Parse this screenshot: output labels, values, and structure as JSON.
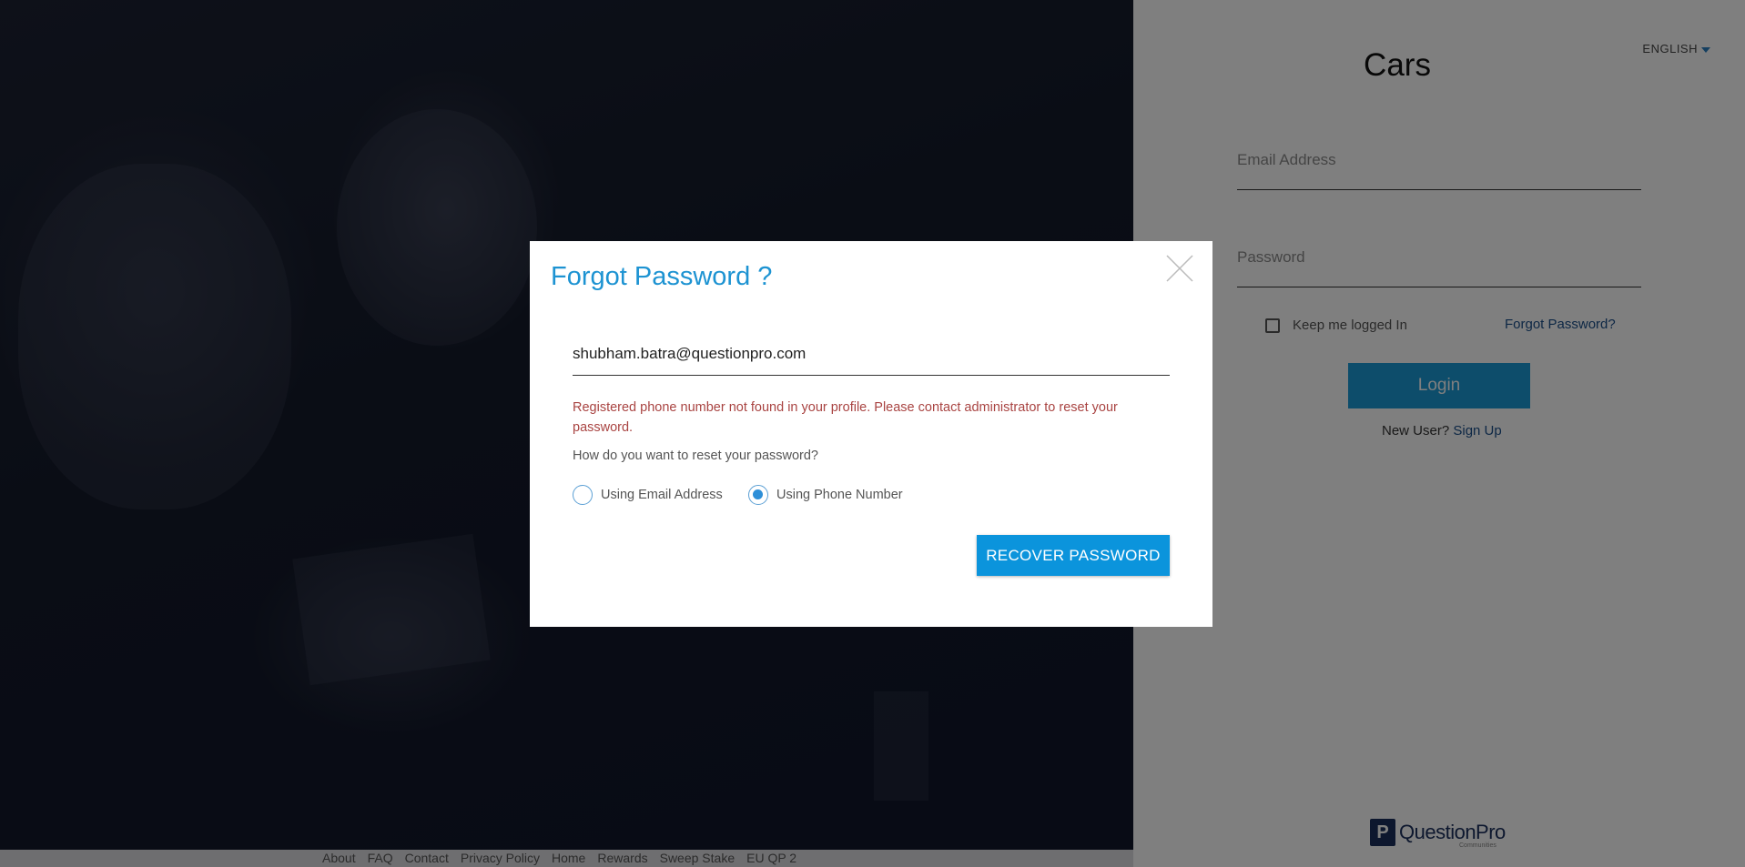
{
  "login_panel": {
    "language": "ENGLISH",
    "app_title": "Cars",
    "email_placeholder": "Email Address",
    "password_placeholder": "Password",
    "keep_logged_in": "Keep me logged In",
    "forgot_password_link": "Forgot Password?",
    "login_button": "Login",
    "new_user_text": "New User?",
    "sign_up_link": "Sign Up",
    "brand_name": "QuestionPro",
    "brand_sub": "Communities"
  },
  "footer": {
    "links": [
      "About",
      "FAQ",
      "Contact",
      "Privacy Policy",
      "Home",
      "Rewards",
      "Sweep Stake",
      "EU QP 2"
    ]
  },
  "modal": {
    "title": "Forgot Password ?",
    "email_value": "shubham.batra@questionpro.com",
    "error_message": "Registered phone number not found in your profile. Please contact administrator to reset your password.",
    "question": "How do you want to reset your password?",
    "options": [
      {
        "label": "Using Email Address",
        "checked": false
      },
      {
        "label": "Using Phone Number",
        "checked": true
      }
    ],
    "recover_button": "RECOVER PASSWORD"
  },
  "colors": {
    "accent": "#1d93d2",
    "error": "#a94442",
    "button": "#0b94dc"
  }
}
